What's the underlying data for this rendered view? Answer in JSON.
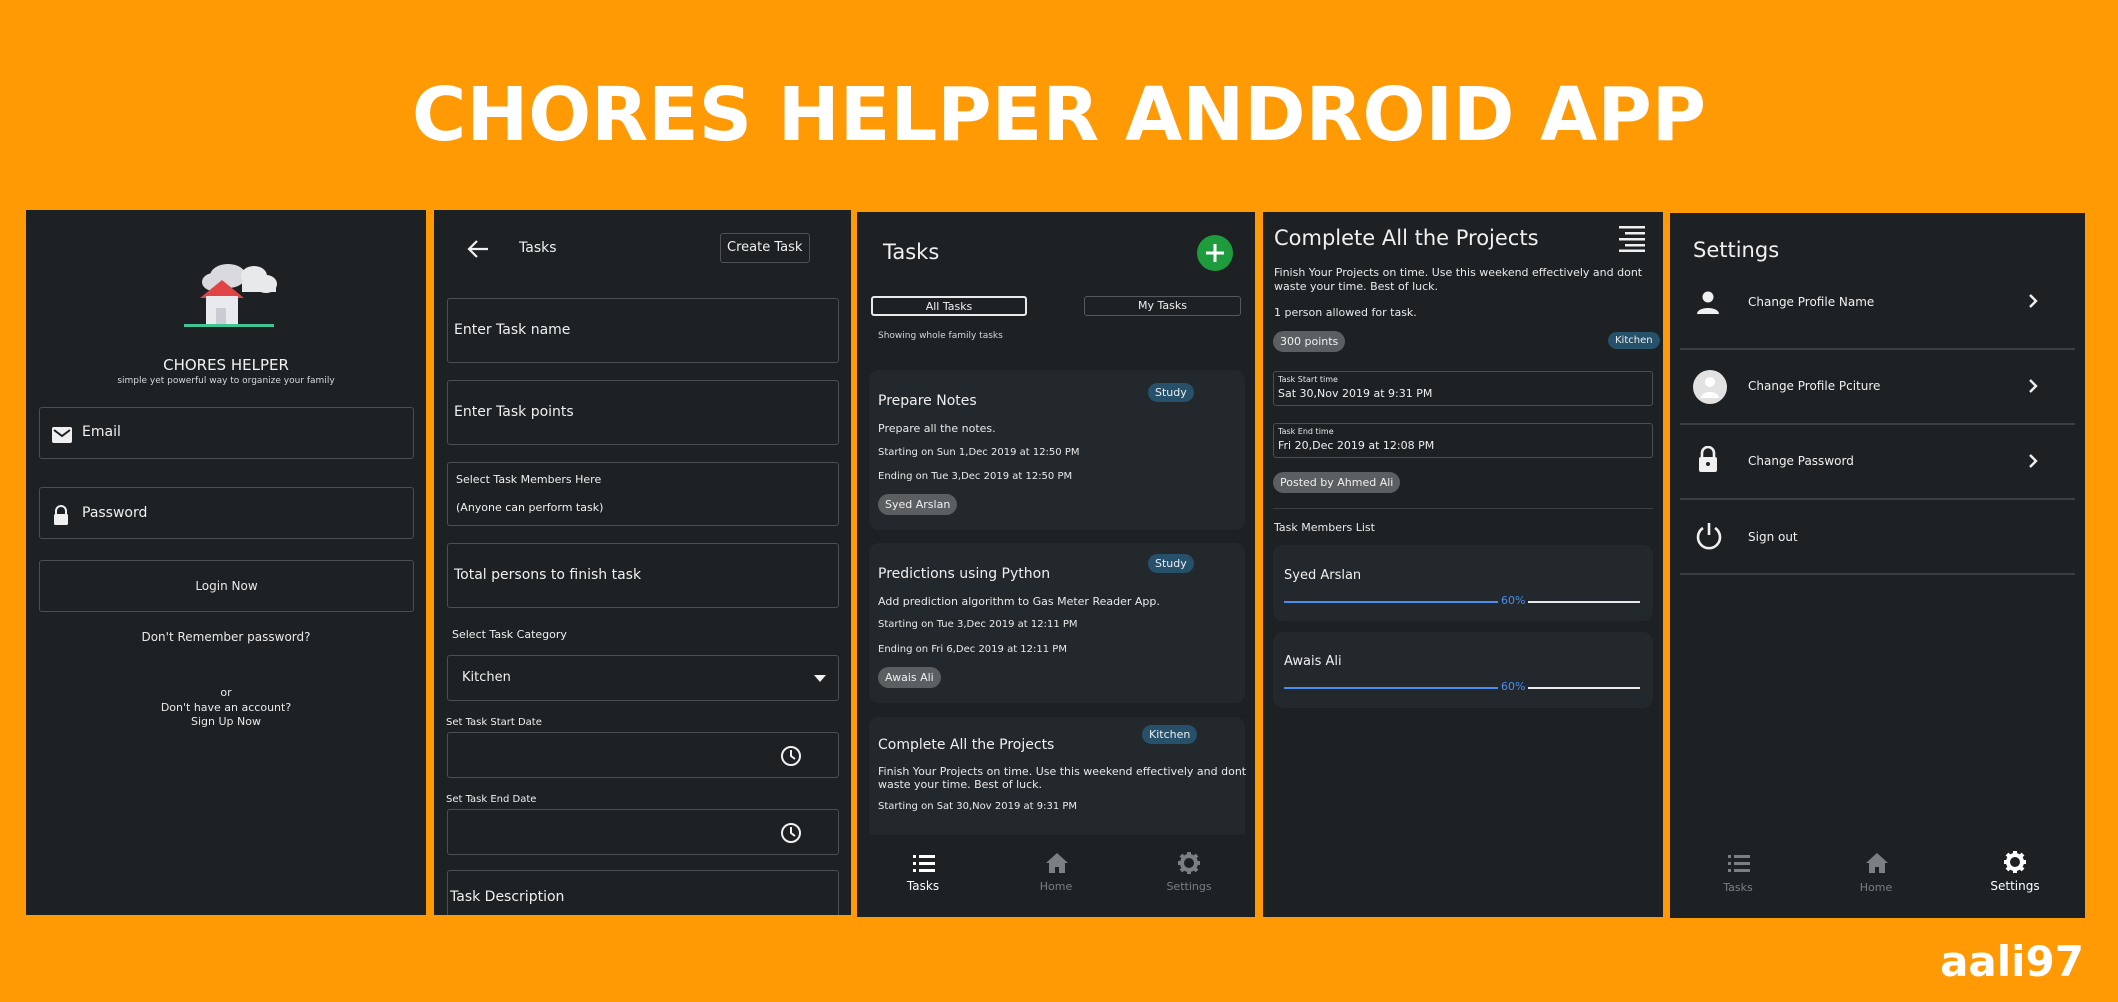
{
  "header": {
    "title": "CHORES HELPER ANDROID APP",
    "brand": "aali97"
  },
  "login": {
    "app_name": "CHORES HELPER",
    "tagline": "simple yet powerful way to organize your family",
    "email_placeholder": "Email",
    "password_placeholder": "Password",
    "login_button": "Login Now",
    "forgot": "Don't Remember password?",
    "or": "or",
    "no_account": "Don't have an account?",
    "signup": "Sign Up Now"
  },
  "create_task": {
    "title": "Tasks",
    "create_button": "Create Task",
    "task_name": "Enter Task name",
    "task_points": "Enter Task points",
    "members_label": "Select Task Members Here",
    "members_value": "(Anyone can perform task)",
    "total_persons": "Total persons to finish task",
    "category_label": "Select Task Category",
    "category_value": "Kitchen",
    "start_label": "Set Task Start Date",
    "end_label": "Set Task End Date",
    "description": "Task Description"
  },
  "task_list": {
    "title": "Tasks",
    "tab_all": "All Tasks",
    "tab_mine": "My Tasks",
    "subtitle": "Showing whole family tasks",
    "cards": [
      {
        "title": "Prepare Notes",
        "badge": "Study",
        "desc": "Prepare all the notes.",
        "start": "Starting on Sun 1,Dec 2019  at  12:50 PM",
        "end": "Ending on Tue 3,Dec 2019  at  12:50 PM",
        "person": "Syed Arslan"
      },
      {
        "title": "Predictions using Python",
        "badge": "Study",
        "desc": "Add prediction algorithm to Gas Meter Reader App.",
        "start": "Starting on Tue 3,Dec 2019  at  12:11 PM",
        "end": "Ending on Fri 6,Dec 2019  at  12:11 PM",
        "person": "Awais Ali"
      },
      {
        "title": "Complete All the Projects",
        "badge": "Kitchen",
        "desc1": "Finish Your Projects on time. Use this weekend effectively and dont",
        "desc2": "waste your time. Best of luck.",
        "start": "Starting on Sat 30,Nov 2019  at  9:31 PM"
      }
    ]
  },
  "nav": {
    "tasks": "Tasks",
    "home": "Home",
    "settings": "Settings"
  },
  "detail": {
    "title": "Complete All the Projects",
    "desc1": "Finish Your Projects on time. Use this weekend effectively and dont",
    "desc2": "waste your time. Best of luck.",
    "allowed": "1 person allowed for task.",
    "points": "300 points",
    "category": "Kitchen",
    "start_label": "Task Start time",
    "start_value": "Sat 30,Nov 2019  at  9:31 PM",
    "end_label": "Task End time",
    "end_value": "Fri 20,Dec 2019  at  12:08 PM",
    "posted_by": "Posted by Ahmed Ali",
    "members_title": "Task Members List",
    "members": [
      {
        "name": "Syed Arslan",
        "progress_label": "60%",
        "progress": 0.6
      },
      {
        "name": "Awais Ali",
        "progress_label": "60%",
        "progress": 0.6
      }
    ]
  },
  "settings": {
    "title": "Settings",
    "items": [
      {
        "label": "Change Profile Name",
        "icon": "person-icon"
      },
      {
        "label": "Change Profile Pciture",
        "icon": "avatar-icon"
      },
      {
        "label": "Change Password",
        "icon": "lock-icon"
      },
      {
        "label": "Sign out",
        "icon": "power-icon"
      }
    ]
  },
  "colors": {
    "background": "#ff9a05",
    "phone": "#1d2124",
    "card": "#23282c",
    "accent_green": "#1e9b3c",
    "badge": "#27506a",
    "progress": "#4a8df0"
  }
}
